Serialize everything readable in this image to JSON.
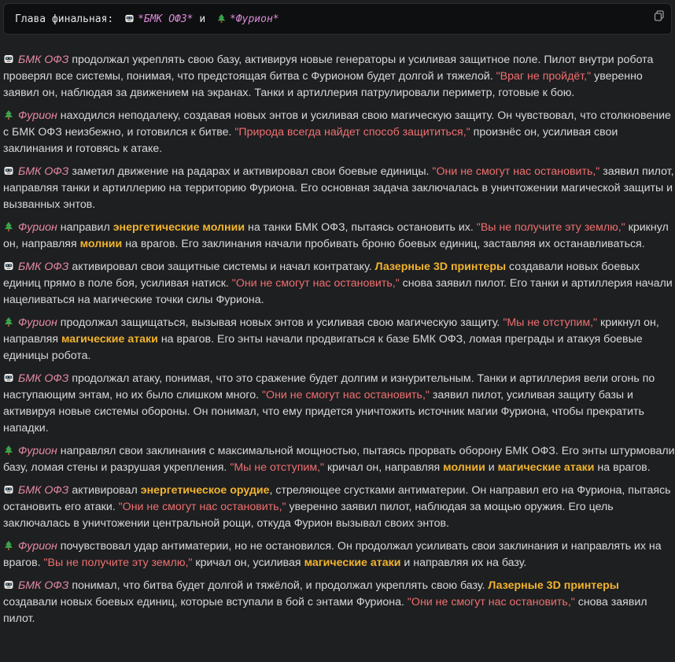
{
  "header": {
    "prefix": "Глава финальная:",
    "bmk": "*БМК ОФЗ*",
    "and": "и",
    "furion": "*Фурион*"
  },
  "icons": {
    "robot": "robot-face-icon",
    "tree": "evergreen-tree-icon",
    "copy": "copy-icon"
  },
  "colors": {
    "name": "#e58aa3",
    "quote": "#ef6f6f",
    "highlight": "#f2b32e",
    "text": "#d8d8d8"
  },
  "paragraphs": [
    {
      "icon": "robot",
      "segments": [
        {
          "t": "name",
          "v": "БМК ОФЗ"
        },
        {
          "t": "text",
          "v": " продолжал укреплять свою базу, активируя новые генераторы и усиливая защитное поле. Пилот внутри робота проверял все системы, понимая, что предстоящая битва с Фурионом будет долгой и тяжелой. "
        },
        {
          "t": "quote",
          "v": "\"Враг не пройдёт,\""
        },
        {
          "t": "text",
          "v": " уверенно заявил он, наблюдая за движением на экранах. Танки и артиллерия патрулировали периметр, готовые к бою."
        }
      ]
    },
    {
      "icon": "tree",
      "segments": [
        {
          "t": "name",
          "v": "Фурион"
        },
        {
          "t": "text",
          "v": " находился неподалеку, создавая новых энтов и усиливая свою магическую защиту. Он чувствовал, что столкновение с БМК ОФЗ неизбежно, и готовился к битве. "
        },
        {
          "t": "quote",
          "v": "\"Природа всегда найдет способ защититься,\""
        },
        {
          "t": "text",
          "v": " произнёс он, усиливая свои заклинания и готовясь к атаке."
        }
      ]
    },
    {
      "icon": "robot",
      "segments": [
        {
          "t": "name",
          "v": "БМК ОФЗ"
        },
        {
          "t": "text",
          "v": " заметил движение на радарах и активировал свои боевые единицы. "
        },
        {
          "t": "quote",
          "v": "\"Они не смогут нас остановить,\""
        },
        {
          "t": "text",
          "v": " заявил пилот, направляя танки и артиллерию на территорию Фуриона. Его основная задача заключалась в уничтожении магической защиты и вызванных энтов."
        }
      ]
    },
    {
      "icon": "tree",
      "segments": [
        {
          "t": "name",
          "v": "Фурион"
        },
        {
          "t": "text",
          "v": " направил "
        },
        {
          "t": "hl",
          "v": "энергетические молнии"
        },
        {
          "t": "text",
          "v": " на танки БМК ОФЗ, пытаясь остановить их. "
        },
        {
          "t": "quote",
          "v": "\"Вы не получите эту землю,\""
        },
        {
          "t": "text",
          "v": " крикнул он, направляя "
        },
        {
          "t": "hl",
          "v": "молнии"
        },
        {
          "t": "text",
          "v": " на врагов. Его заклинания начали пробивать броню боевых единиц, заставляя их останавливаться."
        }
      ]
    },
    {
      "icon": "robot",
      "segments": [
        {
          "t": "name",
          "v": "БМК ОФЗ"
        },
        {
          "t": "text",
          "v": " активировал свои защитные системы и начал контратаку. "
        },
        {
          "t": "hl",
          "v": "Лазерные 3D принтеры"
        },
        {
          "t": "text",
          "v": " создавали новых боевых единиц прямо в поле боя, усиливая натиск. "
        },
        {
          "t": "quote",
          "v": "\"Они не смогут нас остановить,\""
        },
        {
          "t": "text",
          "v": " снова заявил пилот. Его танки и артиллерия начали нацеливаться на магические точки силы Фуриона."
        }
      ]
    },
    {
      "icon": "tree",
      "segments": [
        {
          "t": "name",
          "v": "Фурион"
        },
        {
          "t": "text",
          "v": " продолжал защищаться, вызывая новых энтов и усиливая свою магическую защиту. "
        },
        {
          "t": "quote",
          "v": "\"Мы не отступим,\""
        },
        {
          "t": "text",
          "v": " крикнул он, направляя "
        },
        {
          "t": "hl",
          "v": "магические атаки"
        },
        {
          "t": "text",
          "v": " на врагов. Его энты начали продвигаться к базе БМК ОФЗ, ломая преграды и атакуя боевые единицы робота."
        }
      ]
    },
    {
      "icon": "robot",
      "segments": [
        {
          "t": "name",
          "v": "БМК ОФЗ"
        },
        {
          "t": "text",
          "v": " продолжал атаку, понимая, что это сражение будет долгим и изнурительным. Танки и артиллерия вели огонь по наступающим энтам, но их было слишком много. "
        },
        {
          "t": "quote",
          "v": "\"Они не смогут нас остановить,\""
        },
        {
          "t": "text",
          "v": " заявил пилот, усиливая защиту базы и активируя новые системы обороны. Он понимал, что ему придется уничтожить источник магии Фуриона, чтобы прекратить нападки."
        }
      ]
    },
    {
      "icon": "tree",
      "segments": [
        {
          "t": "name",
          "v": "Фурион"
        },
        {
          "t": "text",
          "v": " направлял свои заклинания с максимальной мощностью, пытаясь прорвать оборону БМК ОФЗ. Его энты штурмовали базу, ломая стены и разрушая укрепления. "
        },
        {
          "t": "quote",
          "v": "\"Мы не отступим,\""
        },
        {
          "t": "text",
          "v": " кричал он, направляя "
        },
        {
          "t": "hl",
          "v": "молнии"
        },
        {
          "t": "text",
          "v": " и "
        },
        {
          "t": "hl",
          "v": "магические атаки"
        },
        {
          "t": "text",
          "v": " на врагов."
        }
      ]
    },
    {
      "icon": "robot",
      "segments": [
        {
          "t": "name",
          "v": "БМК ОФЗ"
        },
        {
          "t": "text",
          "v": " активировал "
        },
        {
          "t": "hl",
          "v": "энергетическое орудие"
        },
        {
          "t": "text",
          "v": ", стреляющее сгустками антиматерии. Он направил его на Фуриона, пытаясь остановить его атаки. "
        },
        {
          "t": "quote",
          "v": "\"Они не смогут нас остановить,\""
        },
        {
          "t": "text",
          "v": " уверенно заявил пилот, наблюдая за мощью оружия. Его цель заключалась в уничтожении центральной рощи, откуда Фурион вызывал своих энтов."
        }
      ]
    },
    {
      "icon": "tree",
      "segments": [
        {
          "t": "name",
          "v": "Фурион"
        },
        {
          "t": "text",
          "v": " почувствовал удар антиматерии, но не остановился. Он продолжал усиливать свои заклинания и направлять их на врагов. "
        },
        {
          "t": "quote",
          "v": "\"Вы не получите эту землю,\""
        },
        {
          "t": "text",
          "v": " кричал он, усиливая "
        },
        {
          "t": "hl",
          "v": "магические атаки"
        },
        {
          "t": "text",
          "v": " и направляя их на базу."
        }
      ]
    },
    {
      "icon": "robot",
      "segments": [
        {
          "t": "name",
          "v": "БМК ОФЗ"
        },
        {
          "t": "text",
          "v": " понимал, что битва будет долгой и тяжёлой, и продолжал укреплять свою базу. "
        },
        {
          "t": "hl",
          "v": "Лазерные 3D принтеры"
        },
        {
          "t": "text",
          "v": " создавали новых боевых единиц, которые вступали в бой с энтами Фуриона. "
        },
        {
          "t": "quote",
          "v": "\"Они не смогут нас остановить,\""
        },
        {
          "t": "text",
          "v": " снова заявил пилот."
        }
      ]
    }
  ]
}
